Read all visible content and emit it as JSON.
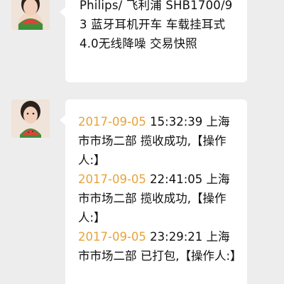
{
  "chat": {
    "product_message": "Philips/ 飞利浦 SHB1700/93 蓝牙耳机开车 车载挂耳式4.0无线降噪 交易快照",
    "tracking": [
      {
        "date": "2017-09-05",
        "time": "15:32:39",
        "text_before": " 上海市市场二部 揽收成功,【操作人:】"
      },
      {
        "date": "2017-09-05",
        "time": "22:41:05",
        "text_before": " 上海市市场二部 揽收成功,【操作人:】"
      },
      {
        "date": "2017-09-05",
        "time": "23:29:21",
        "text_before": " 上海市市场二部 已打包,【操作人:】"
      }
    ]
  },
  "colors": {
    "background": "#ededed",
    "bubble": "#ffffff",
    "date_link": "#e8a33b",
    "text": "#111111"
  },
  "icons": {
    "avatar": "user-avatar-photo"
  }
}
